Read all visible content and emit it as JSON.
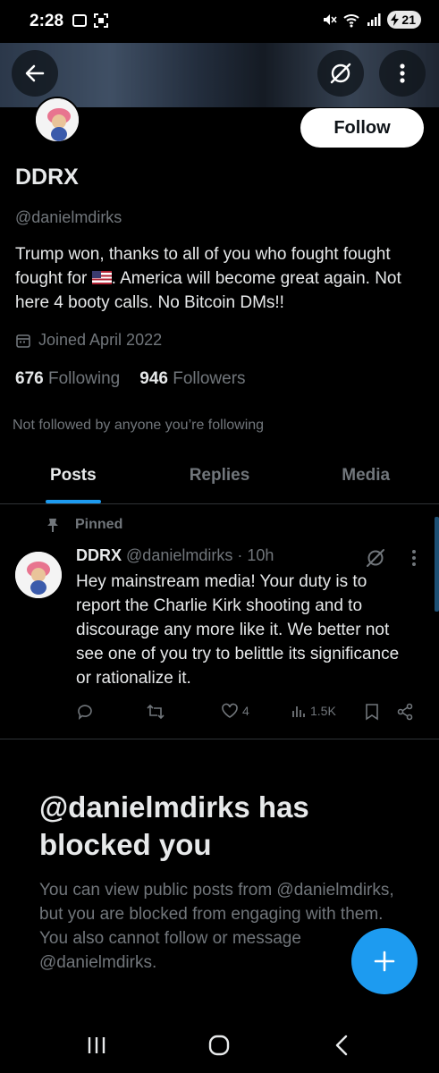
{
  "status_bar": {
    "time": "2:28",
    "battery": "21"
  },
  "icons": {
    "back": "arrow-left-icon",
    "grok": "grok-icon",
    "more": "more-vertical-icon",
    "calendar": "calendar-icon",
    "pin": "pin-icon",
    "reply": "reply-icon",
    "repost": "repost-icon",
    "like": "heart-icon",
    "views": "views-icon",
    "bookmark": "bookmark-icon",
    "share": "share-icon",
    "compose": "plus-icon"
  },
  "profile": {
    "follow_label": "Follow",
    "name": "DDRX",
    "handle": "@danielmdirks",
    "bio_part1": "Trump won, thanks to all of you who fought fought fought for ",
    "bio_part2": ". America will become great again. Not here 4 booty calls. No Bitcoin DMs!!",
    "joined": "Joined April 2022",
    "following_count": "676",
    "following_label": "Following",
    "followers_count": "946",
    "followers_label": "Followers",
    "not_followed": "Not followed by anyone you’re following"
  },
  "tabs": [
    {
      "label": "Posts",
      "active": true
    },
    {
      "label": "Replies",
      "active": false
    },
    {
      "label": "Media",
      "active": false
    }
  ],
  "post": {
    "pinned_label": "Pinned",
    "author_name": "DDRX",
    "author_handle": "@danielmdirks",
    "time": "· 10h",
    "text": "Hey mainstream media! Your duty is to report the Charlie Kirk shooting and to discourage any more like it. We better not see one of you try to belittle its significance or rationalize it.",
    "likes": "4",
    "views": "1.5K"
  },
  "blocked": {
    "title": "@danielmdirks has blocked you",
    "description": "You can view public posts from @danielmdirks, but you are blocked from engaging with them. You also cannot follow or message @danielmdirks."
  },
  "colors": {
    "accent": "#1d9bf0",
    "background": "#000000",
    "muted": "#71767b",
    "text": "#e7e9ea"
  }
}
